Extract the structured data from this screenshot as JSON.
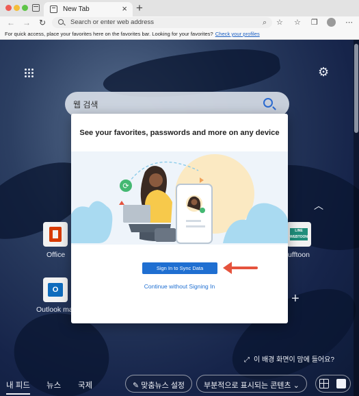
{
  "browser": {
    "tab_title": "New Tab",
    "tab_close": "×",
    "new_tab": "+",
    "address_placeholder": "Search or enter web address",
    "favorites_bar_message": "For quick access, place your favorites here on the favorites bar. Looking for your favorites?",
    "favorites_bar_link": "Check your profiles"
  },
  "newtab": {
    "search_placeholder": "웹 검색",
    "tiles": [
      {
        "label": "Office"
      },
      {
        "label": "Outlook ma"
      },
      {
        "label": "ufftoon"
      }
    ],
    "webtoon_logo_text": "LINE WEBTOON",
    "outlook_logo_text": "O",
    "background_info": "이 배경 화면이 맘에 들어요?",
    "bottom_nav": {
      "my_feed": "내 피드",
      "news": "뉴스",
      "world": "국제",
      "personalize": "맞춤뉴스 설정",
      "content_visibility": "부분적으로 표시되는 콘텐츠"
    }
  },
  "modal": {
    "title": "See your favorites, passwords and more on any device",
    "primary_button": "Sign In to Sync Data",
    "secondary_link": "Continue without Signing In"
  },
  "colors": {
    "primary_button": "#1f6fd1",
    "arrow": "#e5533d"
  }
}
